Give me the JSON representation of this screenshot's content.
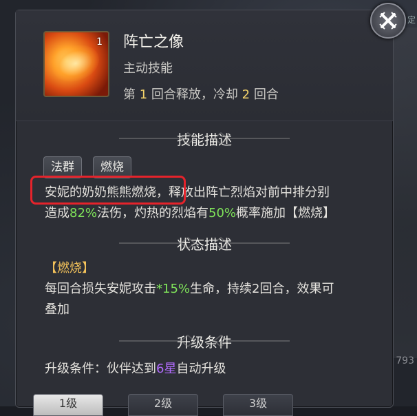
{
  "skill": {
    "level_badge": "1",
    "name": "阵亡之像",
    "type": "主动技能",
    "cooldown_parts": [
      "第 ",
      "1",
      " 回合释放，冷却 ",
      "2",
      " 回合"
    ]
  },
  "sections": {
    "skill_desc_title": "技能描述",
    "status_desc_title": "状态描述",
    "upgrade_title": "升级条件"
  },
  "tags": [
    "法群",
    "燃烧"
  ],
  "skill_desc": {
    "line1": "安妮的奶奶熊熊燃烧，释放出阵亡烈焰对前中排分别",
    "line2_parts": [
      "造成",
      "82%",
      "法伤，灼热的烈焰有",
      "50%",
      "概率施加【燃烧】"
    ]
  },
  "status": {
    "name": "【燃烧】",
    "line1_parts": [
      "每回合损失安妮攻击",
      "*15%",
      "生命，持续2回合，效果可"
    ],
    "line2": "叠加"
  },
  "upgrade": {
    "parts": [
      "升级条件：伙伴达到",
      "6星",
      "自动升级"
    ]
  },
  "bottom_tabs": [
    "1级",
    "2级",
    "3级"
  ],
  "background": {
    "corner_text": "定",
    "side_number": "793"
  },
  "colors": {
    "highlight_yellow": "#f3d36a",
    "highlight_green": "#7fe35a",
    "highlight_purple": "#b36cff",
    "annotation_red": "#e5232b"
  }
}
